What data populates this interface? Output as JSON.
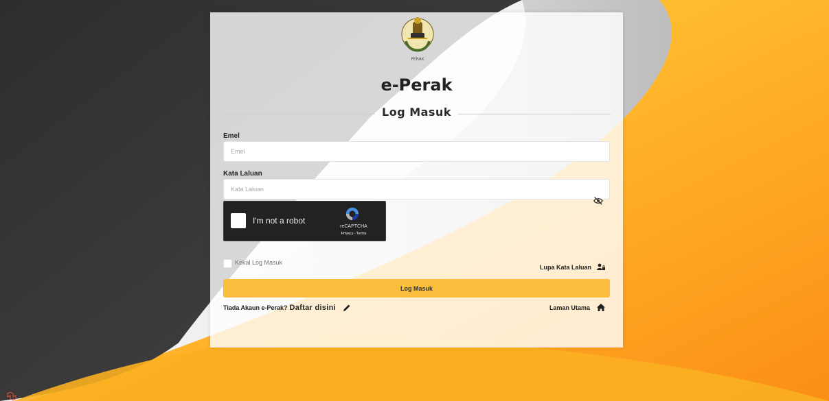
{
  "header": {
    "logo_caption": "PERAK",
    "brand": "e-Perak",
    "section_title": "Log Masuk"
  },
  "form": {
    "email": {
      "label": "Emel",
      "placeholder": "Emel",
      "value": ""
    },
    "password": {
      "label": "Kata Laluan",
      "placeholder": "Kata Laluan",
      "value": ""
    },
    "remember_label": "Kekal Log Masuk",
    "forgot_label": "Lupa Kata Laluan",
    "submit_label": "Log Masuk"
  },
  "captcha": {
    "label": "I'm not a robot",
    "brand": "reCAPTCHA",
    "links": "Privacy - Terms"
  },
  "footer": {
    "no_account_text": "Tiada Akaun e-Perak?",
    "register_label": "Daftar disini",
    "home_label": "Laman Utama"
  },
  "icons": {
    "logo": "perak-crest-icon",
    "password_toggle": "eye-slash-icon",
    "forgot": "user-lock-icon",
    "register": "pencil-icon",
    "home": "home-icon",
    "corner": "laravel-icon"
  },
  "colors": {
    "accent": "#fbbe3c",
    "background_dark": "#333333",
    "background_orange": "#fb9b1c",
    "captcha_bg": "#222222"
  }
}
